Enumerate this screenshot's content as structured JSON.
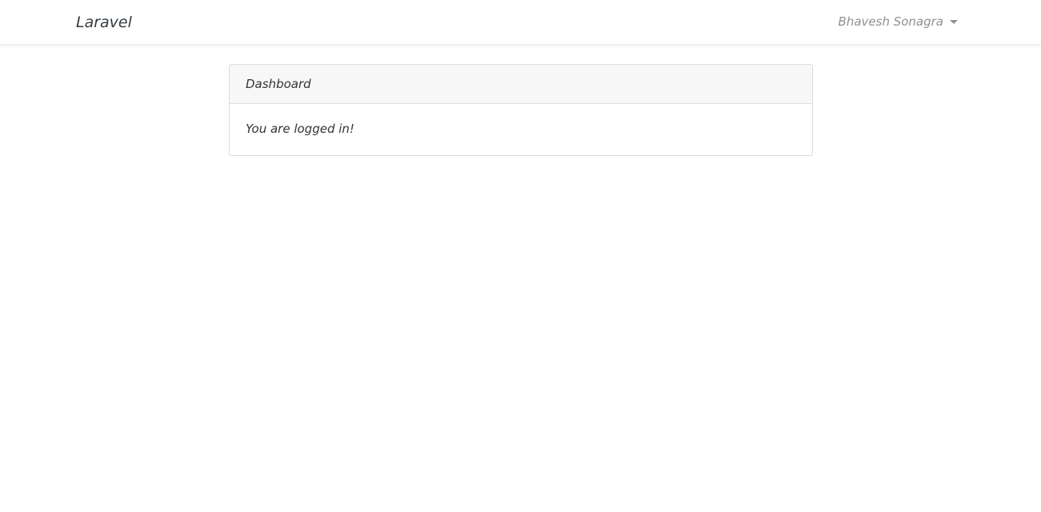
{
  "navbar": {
    "brand": "Laravel",
    "user_name": "Bhavesh Sonagra"
  },
  "card": {
    "header": "Dashboard",
    "body": "You are logged in!"
  },
  "icons": {
    "user_menu_caret": "caret-down-icon"
  }
}
